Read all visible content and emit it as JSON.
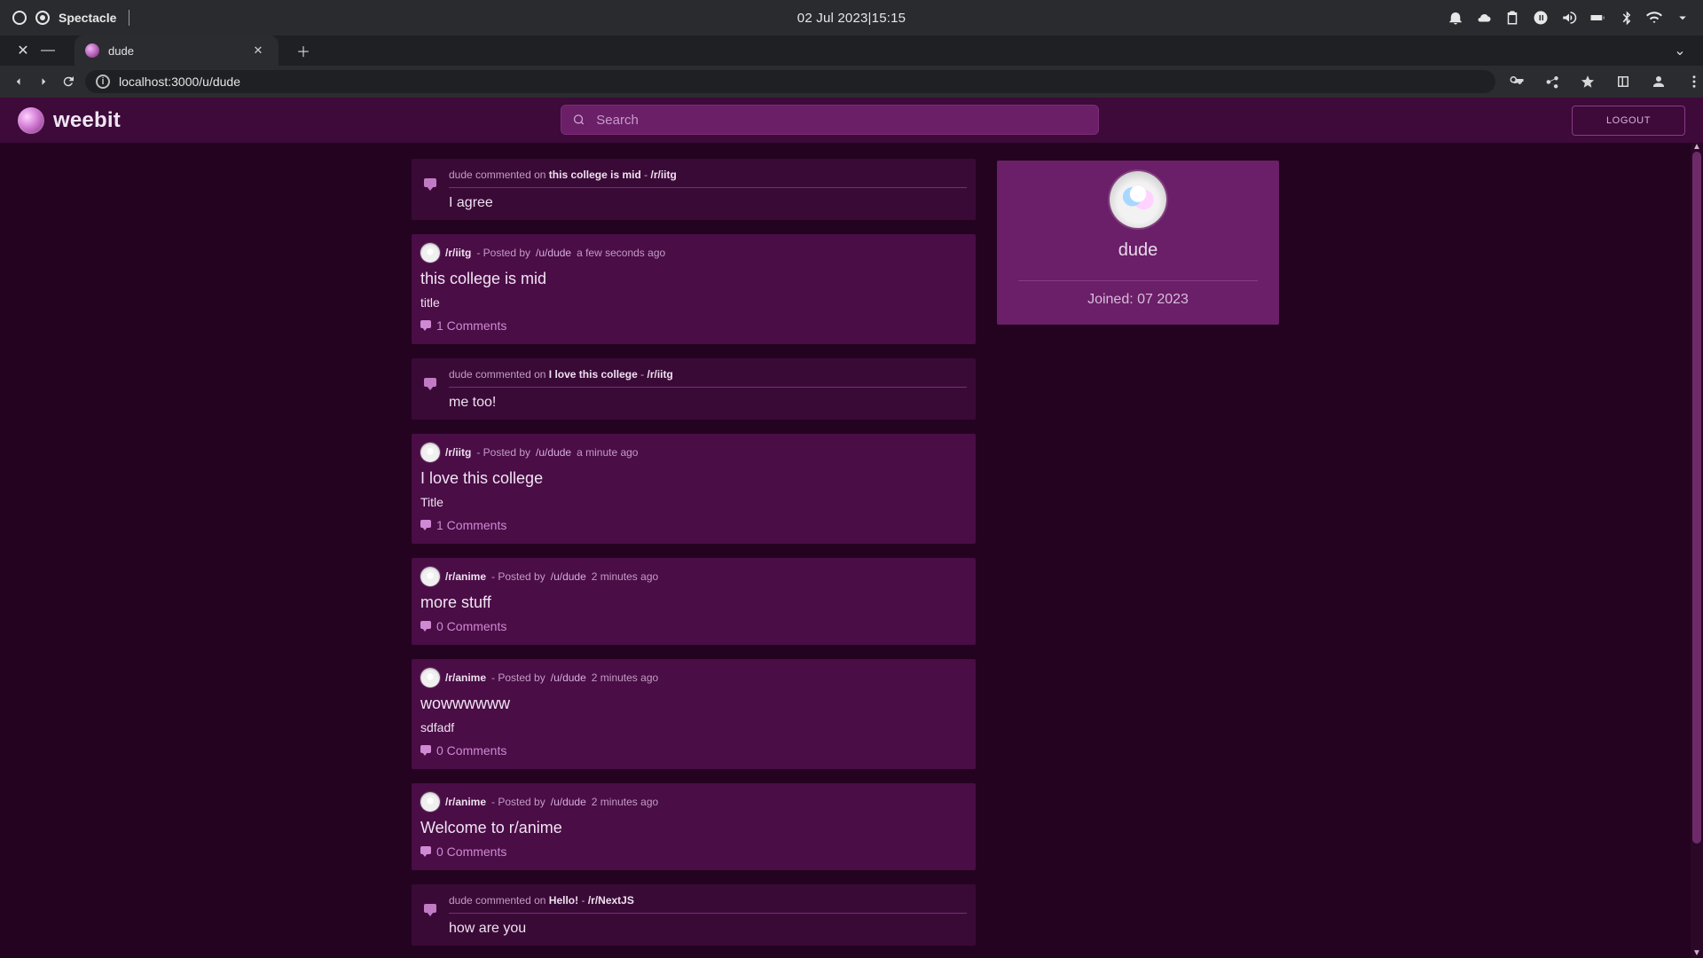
{
  "system": {
    "app_name": "Spectacle",
    "datetime": "02 Jul 2023|15:15"
  },
  "browser": {
    "tab_title": "dude",
    "url": "localhost:3000/u/dude"
  },
  "app": {
    "brand": "weebit",
    "search_placeholder": "Search",
    "logout_label": "LOGOUT"
  },
  "profile": {
    "username": "dude",
    "joined": "Joined: 07 2023"
  },
  "feed": [
    {
      "type": "comment",
      "meta": {
        "author": "dude",
        "verb": "commented on",
        "post_title": "this college is mid",
        "sub": "/r/iitg"
      },
      "text": "I agree"
    },
    {
      "type": "post",
      "meta": {
        "sub": "/r/iitg",
        "posted_by": "/u/dude",
        "time": "a few seconds ago"
      },
      "title": "this college is mid",
      "body": "title",
      "comments": "1 Comments"
    },
    {
      "type": "comment",
      "meta": {
        "author": "dude",
        "verb": "commented on",
        "post_title": "I love this college",
        "sub": "/r/iitg"
      },
      "text": "me too!"
    },
    {
      "type": "post",
      "meta": {
        "sub": "/r/iitg",
        "posted_by": "/u/dude",
        "time": "a minute ago"
      },
      "title": "I love this college",
      "body": "Title",
      "comments": "1 Comments"
    },
    {
      "type": "post",
      "meta": {
        "sub": "/r/anime",
        "posted_by": "/u/dude",
        "time": "2 minutes ago"
      },
      "title": "more stuff",
      "body": "",
      "comments": "0 Comments"
    },
    {
      "type": "post",
      "meta": {
        "sub": "/r/anime",
        "posted_by": "/u/dude",
        "time": "2 minutes ago"
      },
      "title": "wowwwwww",
      "body": "sdfadf",
      "comments": "0 Comments"
    },
    {
      "type": "post",
      "meta": {
        "sub": "/r/anime",
        "posted_by": "/u/dude",
        "time": "2 minutes ago"
      },
      "title": "Welcome to r/anime",
      "body": "",
      "comments": "0 Comments"
    },
    {
      "type": "comment",
      "meta": {
        "author": "dude",
        "verb": "commented on",
        "post_title": "Hello!",
        "sub": "/r/NextJS"
      },
      "text": "how are you"
    }
  ]
}
